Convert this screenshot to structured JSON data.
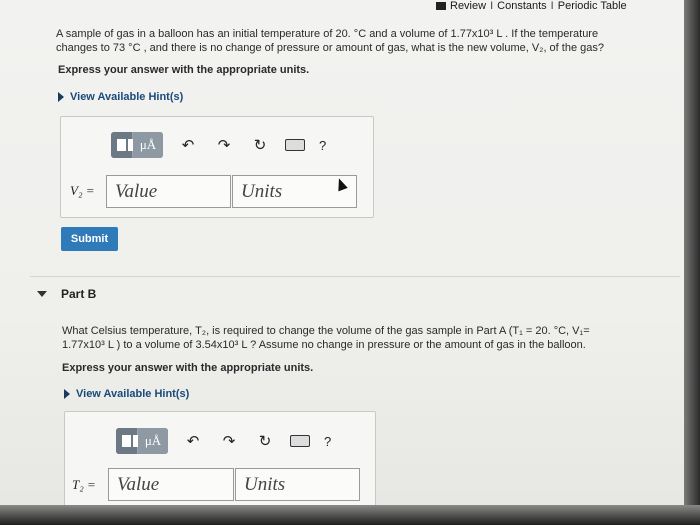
{
  "header": {
    "review": "Review",
    "constants": "Constants",
    "periodic_table": "Periodic Table",
    "sep": "I"
  },
  "partA": {
    "question_l1": "A sample of gas in a balloon has an initial temperature of 20. °C and a volume of 1.77x10³ L . If the temperature",
    "question_l2": "changes to 73 °C , and there is no change of pressure or amount of gas, what is the new volume, V₂, of the gas?",
    "express": "Express your answer with the appropriate units.",
    "hint": "View Available Hint(s)",
    "variable": "V₂ =",
    "value_placeholder": "Value",
    "units_placeholder": "Units",
    "submit": "Submit",
    "mu_label": "μÅ"
  },
  "partB": {
    "title": "Part B",
    "question_l1": "What Celsius temperature, T₂, is required to change the volume of the gas sample in Part A (T₁ = 20. °C, V₁=",
    "question_l2": "1.77x10³ L ) to a volume of 3.54x10³ L ? Assume no change in pressure or the amount of gas in the balloon.",
    "express": "Express your answer with the appropriate units.",
    "hint": "View Available Hint(s)",
    "variable": "T₂ =",
    "value_placeholder": "Value",
    "units_placeholder": "Units",
    "mu_label": "μÅ"
  },
  "toolbar": {
    "undo": "↶",
    "redo": "↷",
    "reset": "↻",
    "help": "?"
  }
}
